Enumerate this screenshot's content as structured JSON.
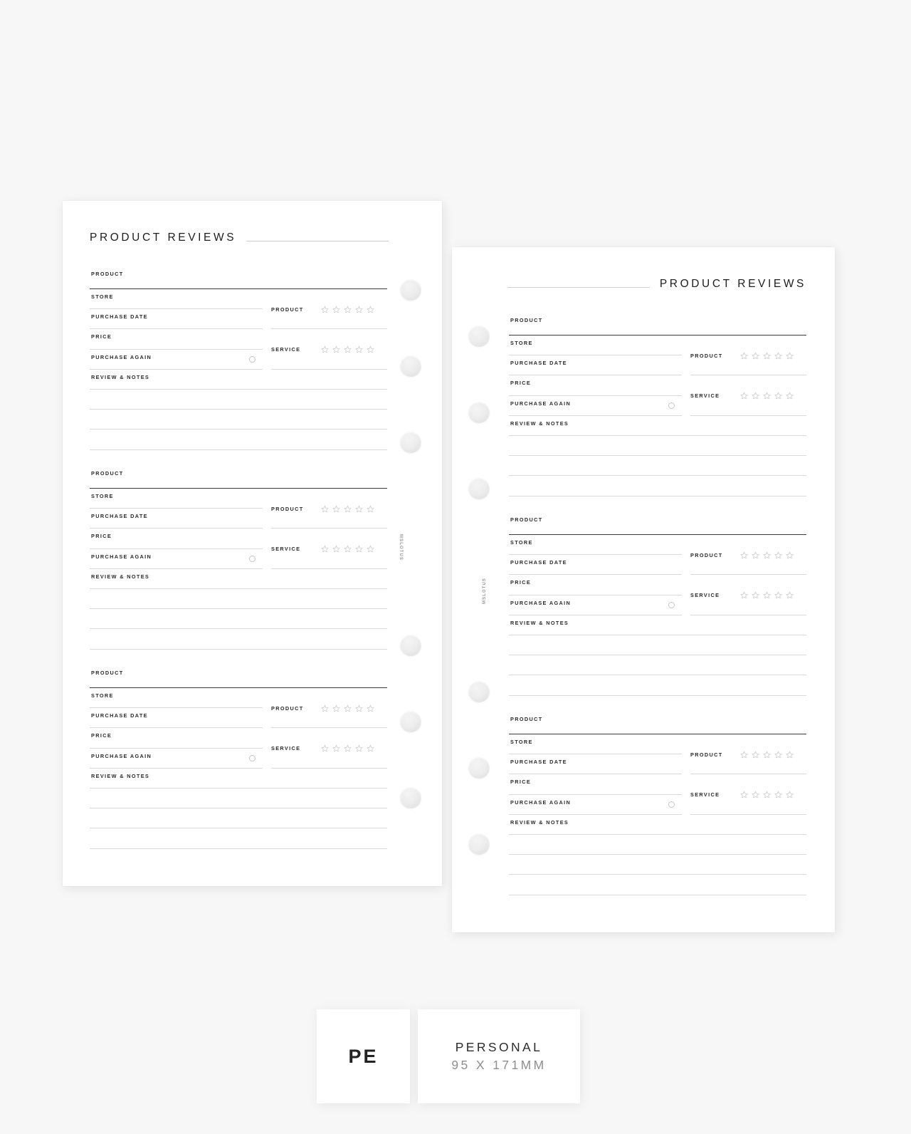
{
  "canvas": {
    "background": "#f7f7f7"
  },
  "title": "PRODUCT REVIEWS",
  "labels": {
    "product": "PRODUCT",
    "store": "STORE",
    "purchase_date": "PURCHASE DATE",
    "price": "PRICE",
    "purchase_again": "PURCHASE AGAIN",
    "review_notes": "REVIEW & NOTES",
    "rating_product": "PRODUCT",
    "rating_service": "SERVICE"
  },
  "rating": {
    "max_stars": 5,
    "filled": 0,
    "star_icon": "star-outline-icon",
    "star_color": "#c9c9c9"
  },
  "checkbox": {
    "icon": "circle-checkbox-icon",
    "checked": false,
    "color": "#c6c6c6"
  },
  "notes": {
    "line_count": 3
  },
  "pages": [
    {
      "id": "left-page",
      "title_align": "left",
      "holes_side": "right",
      "entries": 3,
      "watermark": "MSLOTUS"
    },
    {
      "id": "right-page",
      "title_align": "right",
      "holes_side": "left",
      "entries": 3,
      "watermark": "MSLOTUS"
    }
  ],
  "footer": {
    "size_code": "PE",
    "size_name": "PERSONAL",
    "size_dims": "95 X 171MM"
  },
  "colors": {
    "page": "#ffffff",
    "background": "#f7f7f7",
    "text_dark": "#1d1d1d",
    "label": "#2b2b2b",
    "rule_strong": "#3a3a3a",
    "rule_light": "#d9d9d9",
    "muted": "#8e8e8e",
    "hole": "#ededed"
  }
}
